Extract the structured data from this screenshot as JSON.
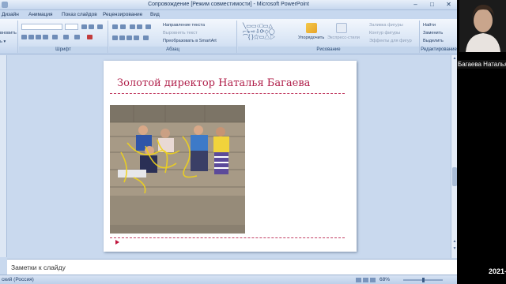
{
  "window": {
    "title": "Сопровождение [Режим совместимости] - Microsoft PowerPoint",
    "controls": {
      "minimize": "–",
      "maximize": "□",
      "close": "✕"
    }
  },
  "tabs": [
    "Дизайн",
    "Анимация",
    "Показ слайдов",
    "Рецензирование",
    "Вид"
  ],
  "ribbon": {
    "clipboard_fragment": "вновить",
    "groups": {
      "font": "Шрифт",
      "paragraph": "Абзац",
      "drawing": "Рисование",
      "editing": "Редактирование"
    },
    "paragraph_items": [
      "Направление текста",
      "Выровнять текст",
      "Преобразовать в SmartArt"
    ],
    "drawing_items": [
      "Упорядочить",
      "Экспресс-стили"
    ],
    "shape_format_items": [
      "Заливка фигуры",
      "Контур фигуры",
      "Эффекты для фигур"
    ],
    "editing_items": [
      "Найти",
      "Заменить",
      "Выделить"
    ]
  },
  "slide": {
    "title": "Золотой директор Наталья Багаева"
  },
  "notes": {
    "placeholder": "Заметки к слайду"
  },
  "status": {
    "language": "ский (Россия)",
    "zoom": "68%"
  },
  "call": {
    "participant": "Багаева Наталья",
    "clock": "2021-"
  },
  "colors": {
    "title_accent": "#b01f4a",
    "ribbon_bg": "#d6e3f4",
    "bullet": "#c0143c"
  }
}
